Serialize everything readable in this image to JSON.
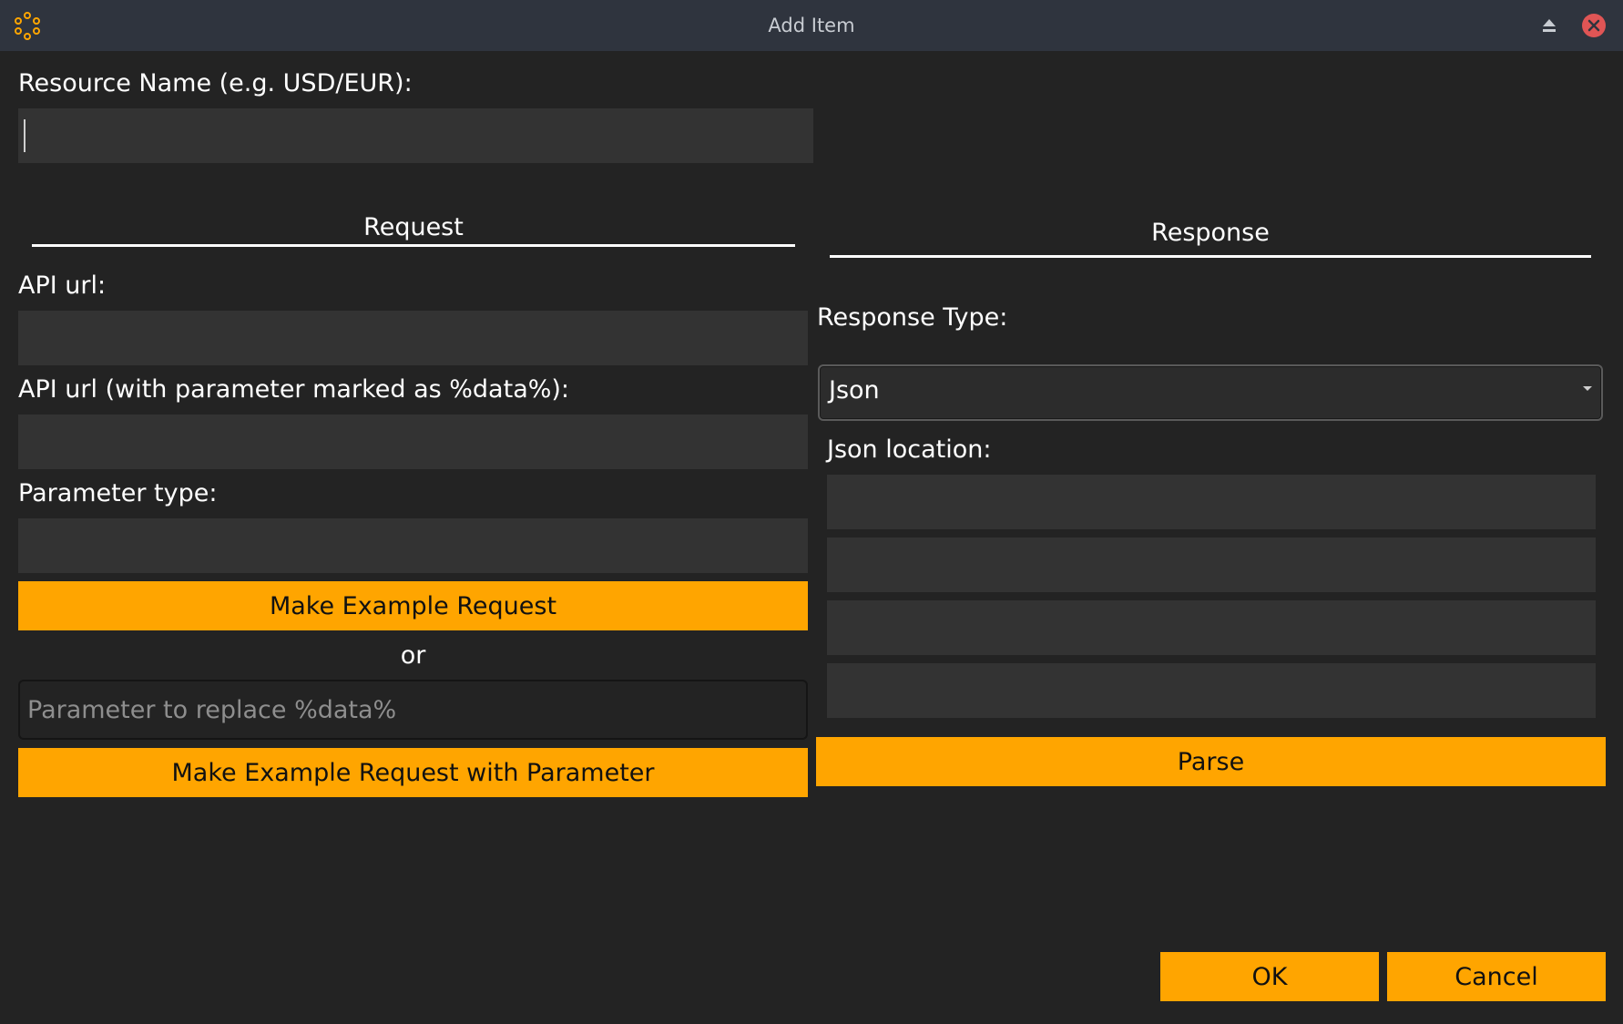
{
  "window": {
    "title": "Add Item",
    "icons": {
      "app": "app-logo-icon",
      "eject": "eject-icon",
      "close": "close-icon"
    },
    "accent_color": "#ffa500",
    "close_color": "#e05555"
  },
  "resource": {
    "label": "Resource Name (e.g. USD/EUR):",
    "value": ""
  },
  "request": {
    "title": "Request",
    "api_url_label": "API url:",
    "api_url_value": "",
    "api_url_param_label": "API url (with parameter marked as %data%):",
    "api_url_param_value": "",
    "parameter_type_label": "Parameter type:",
    "parameter_type_value": "",
    "make_request_button": "Make Example Request",
    "or_text": "or",
    "parameter_placeholder": "Parameter to replace %data%",
    "make_request_param_button": "Make Example Request with Parameter"
  },
  "response": {
    "title": "Response",
    "type_label": "Response Type:",
    "type_selected": "Json",
    "json_location_label": "Json location:",
    "json_location_fields": [
      "",
      "",
      "",
      ""
    ],
    "parse_button": "Parse"
  },
  "footer": {
    "ok_button": "OK",
    "cancel_button": "Cancel"
  }
}
